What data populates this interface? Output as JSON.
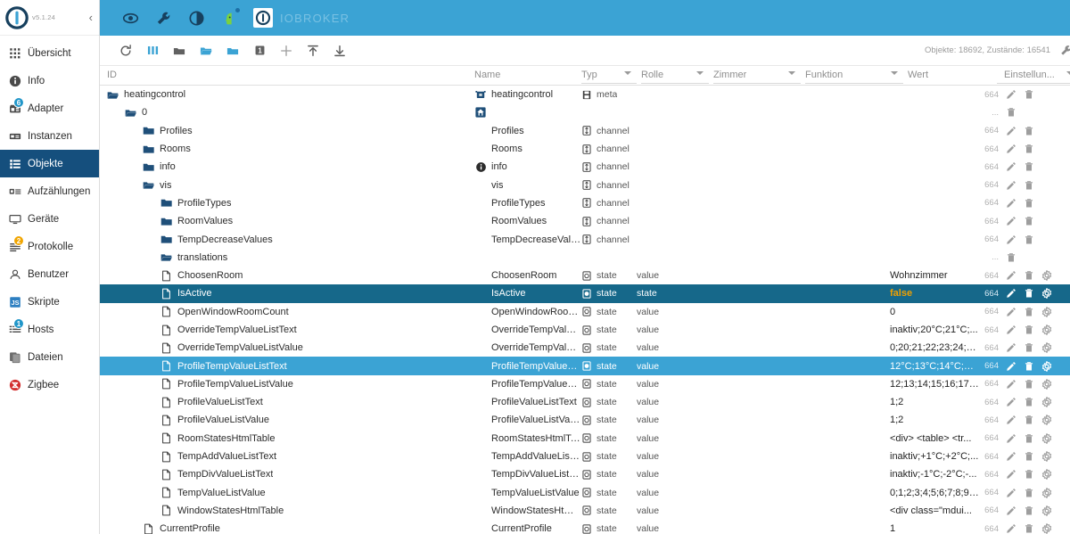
{
  "app": {
    "version": "v5.1.24",
    "title": "IOBROKER",
    "collapse_label": "‹"
  },
  "appbar": {
    "icons": [
      {
        "name": "eye-icon",
        "label": "eye"
      },
      {
        "name": "wrench-icon",
        "label": "wrench"
      },
      {
        "name": "contrast-icon",
        "label": "contrast"
      },
      {
        "name": "head-icon",
        "label": "expert-mode"
      }
    ]
  },
  "sidebar": {
    "items": [
      {
        "label": "Übersicht",
        "icon": "grid-icon",
        "badge": null,
        "active": false
      },
      {
        "label": "Info",
        "icon": "info-icon",
        "badge": null,
        "active": false
      },
      {
        "label": "Adapter",
        "icon": "adapter-icon",
        "badge": "6",
        "badge_color": "blue",
        "active": false
      },
      {
        "label": "Instanzen",
        "icon": "instances-icon",
        "badge": null,
        "active": false
      },
      {
        "label": "Objekte",
        "icon": "objects-icon",
        "badge": null,
        "active": true
      },
      {
        "label": "Aufzählungen",
        "icon": "enums-icon",
        "badge": null,
        "active": false
      },
      {
        "label": "Geräte",
        "icon": "devices-icon",
        "badge": null,
        "active": false
      },
      {
        "label": "Protokolle",
        "icon": "logs-icon",
        "badge": "2",
        "badge_color": "orange",
        "active": false
      },
      {
        "label": "Benutzer",
        "icon": "user-icon",
        "badge": null,
        "active": false
      },
      {
        "label": "Skripte",
        "icon": "js-icon",
        "badge": null,
        "active": false
      },
      {
        "label": "Hosts",
        "icon": "hosts-icon",
        "badge": "1",
        "badge_color": "blue",
        "active": false
      },
      {
        "label": "Dateien",
        "icon": "files-icon",
        "badge": null,
        "active": false
      },
      {
        "label": "Zigbee",
        "icon": "zigbee-icon",
        "badge": null,
        "active": false
      }
    ]
  },
  "toolbar": {
    "buttons": [
      {
        "name": "refresh-button",
        "icon": "refresh-icon"
      },
      {
        "name": "columns-button",
        "icon": "columns-icon"
      },
      {
        "name": "collapse-all-button",
        "icon": "folder-closed-icon"
      },
      {
        "name": "expand-all-button",
        "icon": "folder-open-icon"
      },
      {
        "name": "expand-level-button",
        "icon": "folder-filled-icon"
      },
      {
        "name": "depth-level-button",
        "icon": "number-one-icon",
        "label": "1"
      },
      {
        "name": "add-object-button",
        "icon": "plus-icon"
      },
      {
        "name": "import-button",
        "icon": "upload-icon"
      },
      {
        "name": "export-button",
        "icon": "download-icon"
      }
    ],
    "status": "Objekte: 18692, Zustände: 16541",
    "settings_icon": "wrench-icon"
  },
  "table": {
    "columns": [
      {
        "key": "id",
        "label": "ID",
        "filter": false
      },
      {
        "key": "name",
        "label": "Name",
        "filter": false
      },
      {
        "key": "typ",
        "label": "Typ",
        "filter": true
      },
      {
        "key": "rolle",
        "label": "Rolle",
        "filter": true
      },
      {
        "key": "zimmer",
        "label": "Zimmer",
        "filter": true
      },
      {
        "key": "funktion",
        "label": "Funktion",
        "filter": true
      },
      {
        "key": "wert",
        "label": "Wert",
        "filter": false
      },
      {
        "key": "einstellungen",
        "label": "Einstellun...",
        "filter": true
      }
    ],
    "rows": [
      {
        "id": "heatingcontrol",
        "indent": 0,
        "icon": "folder-open-icon",
        "name": "heatingcontrol",
        "name_icon": "adapter-icon",
        "typ": "meta",
        "typ_icon": "meta-icon",
        "rolle": "",
        "zimmer": "",
        "funktion": "",
        "wert": "",
        "perm": "664",
        "actions": [
          "edit",
          "delete"
        ],
        "selected": "none"
      },
      {
        "id": "0",
        "indent": 1,
        "icon": "folder-open-icon",
        "name": "",
        "name_icon": "home-icon",
        "typ": "",
        "typ_icon": "",
        "rolle": "",
        "zimmer": "",
        "funktion": "",
        "wert": "",
        "perm": "...",
        "actions": [
          "delete"
        ],
        "selected": "none"
      },
      {
        "id": "Profiles",
        "indent": 2,
        "icon": "folder-icon",
        "name": "Profiles",
        "name_icon": "",
        "typ": "channel",
        "typ_icon": "channel-icon",
        "rolle": "",
        "zimmer": "",
        "funktion": "",
        "wert": "",
        "perm": "664",
        "actions": [
          "edit",
          "delete"
        ],
        "selected": "none"
      },
      {
        "id": "Rooms",
        "indent": 2,
        "icon": "folder-icon",
        "name": "Rooms",
        "name_icon": "",
        "typ": "channel",
        "typ_icon": "channel-icon",
        "rolle": "",
        "zimmer": "",
        "funktion": "",
        "wert": "",
        "perm": "664",
        "actions": [
          "edit",
          "delete"
        ],
        "selected": "none"
      },
      {
        "id": "info",
        "indent": 2,
        "icon": "folder-icon",
        "name": "info",
        "name_icon": "info-icon",
        "typ": "channel",
        "typ_icon": "channel-icon",
        "rolle": "",
        "zimmer": "",
        "funktion": "",
        "wert": "",
        "perm": "664",
        "actions": [
          "edit",
          "delete"
        ],
        "selected": "none"
      },
      {
        "id": "vis",
        "indent": 2,
        "icon": "folder-open-icon",
        "name": "vis",
        "name_icon": "",
        "typ": "channel",
        "typ_icon": "channel-icon",
        "rolle": "",
        "zimmer": "",
        "funktion": "",
        "wert": "",
        "perm": "664",
        "actions": [
          "edit",
          "delete"
        ],
        "selected": "none"
      },
      {
        "id": "ProfileTypes",
        "indent": 3,
        "icon": "folder-icon",
        "name": "ProfileTypes",
        "name_icon": "",
        "typ": "channel",
        "typ_icon": "channel-icon",
        "rolle": "",
        "zimmer": "",
        "funktion": "",
        "wert": "",
        "perm": "664",
        "actions": [
          "edit",
          "delete"
        ],
        "selected": "none"
      },
      {
        "id": "RoomValues",
        "indent": 3,
        "icon": "folder-icon",
        "name": "RoomValues",
        "name_icon": "",
        "typ": "channel",
        "typ_icon": "channel-icon",
        "rolle": "",
        "zimmer": "",
        "funktion": "",
        "wert": "",
        "perm": "664",
        "actions": [
          "edit",
          "delete"
        ],
        "selected": "none"
      },
      {
        "id": "TempDecreaseValues",
        "indent": 3,
        "icon": "folder-icon",
        "name": "TempDecreaseValues",
        "name_icon": "",
        "typ": "channel",
        "typ_icon": "channel-icon",
        "rolle": "",
        "zimmer": "",
        "funktion": "",
        "wert": "",
        "perm": "664",
        "actions": [
          "edit",
          "delete"
        ],
        "selected": "none"
      },
      {
        "id": "translations",
        "indent": 3,
        "icon": "folder-open-icon",
        "name": "",
        "name_icon": "",
        "typ": "",
        "typ_icon": "",
        "rolle": "",
        "zimmer": "",
        "funktion": "",
        "wert": "",
        "perm": "...",
        "actions": [
          "delete"
        ],
        "selected": "none"
      },
      {
        "id": "ChoosenRoom",
        "indent": 3,
        "icon": "file-icon",
        "name": "ChoosenRoom",
        "name_icon": "",
        "typ": "state",
        "typ_icon": "state-icon",
        "rolle": "value",
        "zimmer": "",
        "funktion": "",
        "wert": "Wohnzimmer",
        "perm": "664",
        "actions": [
          "edit",
          "delete",
          "settings"
        ],
        "selected": "none"
      },
      {
        "id": "IsActive",
        "indent": 3,
        "icon": "file-icon",
        "name": "IsActive",
        "name_icon": "",
        "typ": "state",
        "typ_icon": "state-icon-filled",
        "rolle": "state",
        "zimmer": "",
        "funktion": "",
        "wert": "false",
        "perm": "664",
        "actions": [
          "edit",
          "delete",
          "settings"
        ],
        "selected": "dark"
      },
      {
        "id": "OpenWindowRoomCount",
        "indent": 3,
        "icon": "file-icon",
        "name": "OpenWindowRoomCount",
        "name_icon": "",
        "typ": "state",
        "typ_icon": "state-icon",
        "rolle": "value",
        "zimmer": "",
        "funktion": "",
        "wert": "0",
        "perm": "664",
        "actions": [
          "edit",
          "delete",
          "settings"
        ],
        "selected": "none"
      },
      {
        "id": "OverrideTempValueListText",
        "indent": 3,
        "icon": "file-icon",
        "name": "OverrideTempValueListText",
        "name_icon": "",
        "typ": "state",
        "typ_icon": "state-icon",
        "rolle": "value",
        "zimmer": "",
        "funktion": "",
        "wert": "inaktiv;20°C;21°C;...",
        "perm": "664",
        "actions": [
          "edit",
          "delete",
          "settings"
        ],
        "selected": "none"
      },
      {
        "id": "OverrideTempValueListValue",
        "indent": 3,
        "icon": "file-icon",
        "name": "OverrideTempValueListValue",
        "name_icon": "",
        "typ": "state",
        "typ_icon": "state-icon",
        "rolle": "value",
        "zimmer": "",
        "funktion": "",
        "wert": "0;20;21;22;23;24;2...",
        "perm": "664",
        "actions": [
          "edit",
          "delete",
          "settings"
        ],
        "selected": "none"
      },
      {
        "id": "ProfileTempValueListText",
        "indent": 3,
        "icon": "file-icon",
        "name": "ProfileTempValueListText",
        "name_icon": "",
        "typ": "state",
        "typ_icon": "state-icon-filled",
        "rolle": "value",
        "zimmer": "",
        "funktion": "",
        "wert": "12°C;13°C;14°C;15...",
        "perm": "664",
        "actions": [
          "edit",
          "delete",
          "settings"
        ],
        "selected": "light"
      },
      {
        "id": "ProfileTempValueListValue",
        "indent": 3,
        "icon": "file-icon",
        "name": "ProfileTempValueListValue",
        "name_icon": "",
        "typ": "state",
        "typ_icon": "state-icon",
        "rolle": "value",
        "zimmer": "",
        "funktion": "",
        "wert": "12;13;14;15;16;17;...",
        "perm": "664",
        "actions": [
          "edit",
          "delete",
          "settings"
        ],
        "selected": "none"
      },
      {
        "id": "ProfileValueListText",
        "indent": 3,
        "icon": "file-icon",
        "name": "ProfileValueListText",
        "name_icon": "",
        "typ": "state",
        "typ_icon": "state-icon",
        "rolle": "value",
        "zimmer": "",
        "funktion": "",
        "wert": "1;2",
        "perm": "664",
        "actions": [
          "edit",
          "delete",
          "settings"
        ],
        "selected": "none"
      },
      {
        "id": "ProfileValueListValue",
        "indent": 3,
        "icon": "file-icon",
        "name": "ProfileValueListValue",
        "name_icon": "",
        "typ": "state",
        "typ_icon": "state-icon",
        "rolle": "value",
        "zimmer": "",
        "funktion": "",
        "wert": "1;2",
        "perm": "664",
        "actions": [
          "edit",
          "delete",
          "settings"
        ],
        "selected": "none"
      },
      {
        "id": "RoomStatesHtmlTable",
        "indent": 3,
        "icon": "file-icon",
        "name": "RoomStatesHtmlTable",
        "name_icon": "",
        "typ": "state",
        "typ_icon": "state-icon",
        "rolle": "value",
        "zimmer": "",
        "funktion": "",
        "wert": "<div> <table> <tr...",
        "perm": "664",
        "actions": [
          "edit",
          "delete",
          "settings"
        ],
        "selected": "none"
      },
      {
        "id": "TempAddValueListText",
        "indent": 3,
        "icon": "file-icon",
        "name": "TempAddValueListText",
        "name_icon": "",
        "typ": "state",
        "typ_icon": "state-icon",
        "rolle": "value",
        "zimmer": "",
        "funktion": "",
        "wert": "inaktiv;+1°C;+2°C;...",
        "perm": "664",
        "actions": [
          "edit",
          "delete",
          "settings"
        ],
        "selected": "none"
      },
      {
        "id": "TempDivValueListText",
        "indent": 3,
        "icon": "file-icon",
        "name": "TempDivValueListText",
        "name_icon": "",
        "typ": "state",
        "typ_icon": "state-icon",
        "rolle": "value",
        "zimmer": "",
        "funktion": "",
        "wert": "inaktiv;-1°C;-2°C;-...",
        "perm": "664",
        "actions": [
          "edit",
          "delete",
          "settings"
        ],
        "selected": "none"
      },
      {
        "id": "TempValueListValue",
        "indent": 3,
        "icon": "file-icon",
        "name": "TempValueListValue",
        "name_icon": "",
        "typ": "state",
        "typ_icon": "state-icon",
        "rolle": "value",
        "zimmer": "",
        "funktion": "",
        "wert": "0;1;2;3;4;5;6;7;8;9;...",
        "perm": "664",
        "actions": [
          "edit",
          "delete",
          "settings"
        ],
        "selected": "none"
      },
      {
        "id": "WindowStatesHtmlTable",
        "indent": 3,
        "icon": "file-icon",
        "name": "WindowStatesHtmlTable",
        "name_icon": "",
        "typ": "state",
        "typ_icon": "state-icon",
        "rolle": "value",
        "zimmer": "",
        "funktion": "",
        "wert": "<div class=\"mdui...",
        "perm": "664",
        "actions": [
          "edit",
          "delete",
          "settings"
        ],
        "selected": "none"
      },
      {
        "id": "CurrentProfile",
        "indent": 2,
        "icon": "file-icon",
        "name": "CurrentProfile",
        "name_icon": "",
        "typ": "state",
        "typ_icon": "state-icon",
        "rolle": "value",
        "zimmer": "",
        "funktion": "",
        "wert": "1",
        "perm": "664",
        "actions": [
          "edit",
          "delete",
          "settings"
        ],
        "selected": "none"
      }
    ]
  },
  "colors": {
    "accent": "#3ba3d4",
    "sidebar_active": "#154f7d",
    "selection_dark": "#16688a",
    "selection_light": "#3ba3d4",
    "value_highlight": "#f0a000"
  }
}
